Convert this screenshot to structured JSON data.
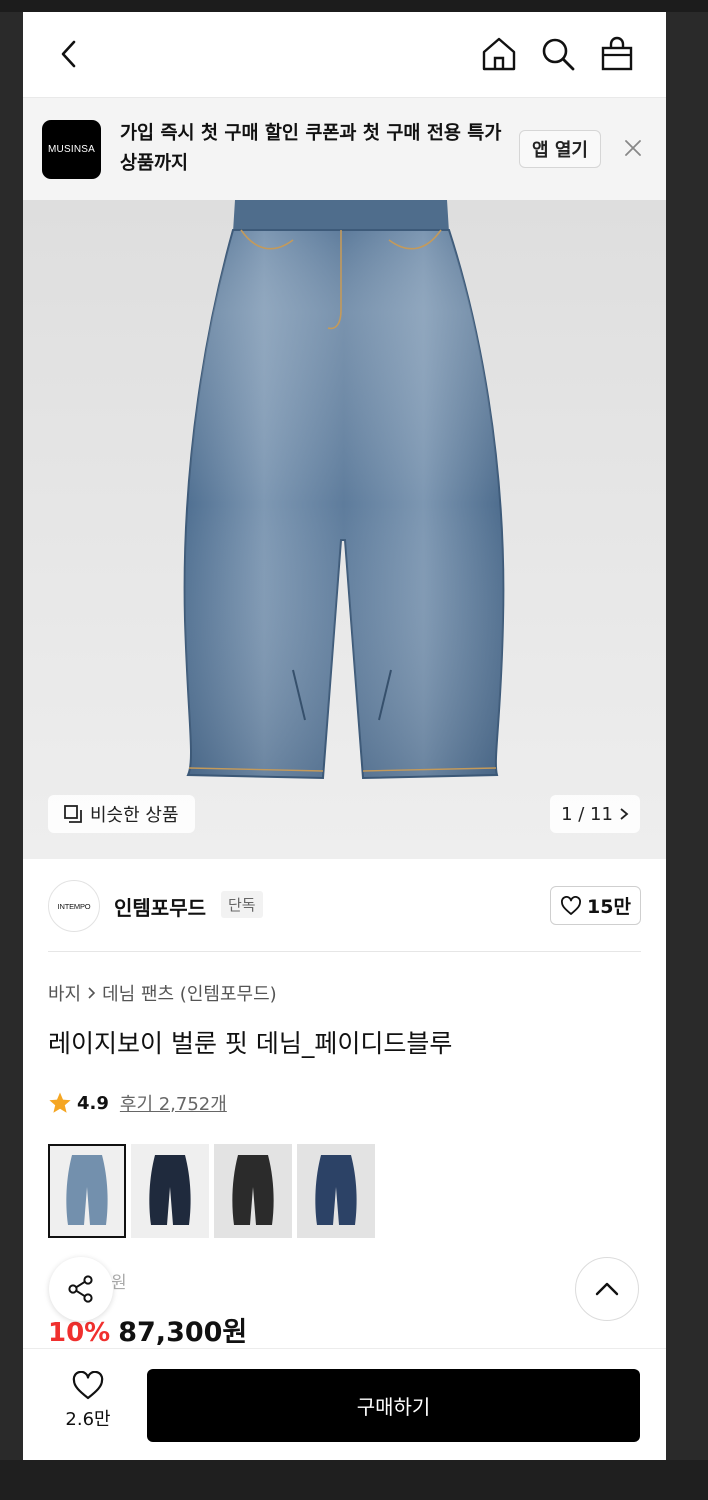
{
  "header": {
    "back_icon": "chevron-left-icon",
    "home_icon": "home-icon",
    "search_icon": "search-icon",
    "cart_icon": "shopping-bag-icon"
  },
  "app_banner": {
    "logo_text": "MUSINSA",
    "message": "가입 즉시 첫 구매 할인 쿠폰과 첫 구매 전용 특가 상품까지",
    "open_app_label": "앱 열기",
    "close_icon": "close-icon"
  },
  "gallery": {
    "similar_label": "비슷한 상품",
    "pager": "1 / 11"
  },
  "brand": {
    "logo_text": "INTEMPO",
    "name": "인템포무드",
    "tag": "단독",
    "likes": "15만"
  },
  "product": {
    "breadcrumb": [
      "바지",
      "데님 팬츠 (인템포무드)"
    ],
    "title": "레이지보이 벌룬 핏 데님_페이디드블루",
    "rating": "4.9",
    "reviews": "후기 2,752개",
    "original_price": "원",
    "discount": "10%",
    "price": "87,300원"
  },
  "color_options": [
    {
      "color": "#6f8ca8",
      "selected": true
    },
    {
      "color": "#1f2a3d",
      "selected": false
    },
    {
      "color": "#2a2a2a",
      "selected": false
    },
    {
      "color": "#2c4266",
      "selected": false
    }
  ],
  "bottom_bar": {
    "wish_count": "2.6만",
    "buy_label": "구매하기"
  },
  "colors": {
    "accent_red": "#f0302e",
    "primary": "#000000"
  }
}
